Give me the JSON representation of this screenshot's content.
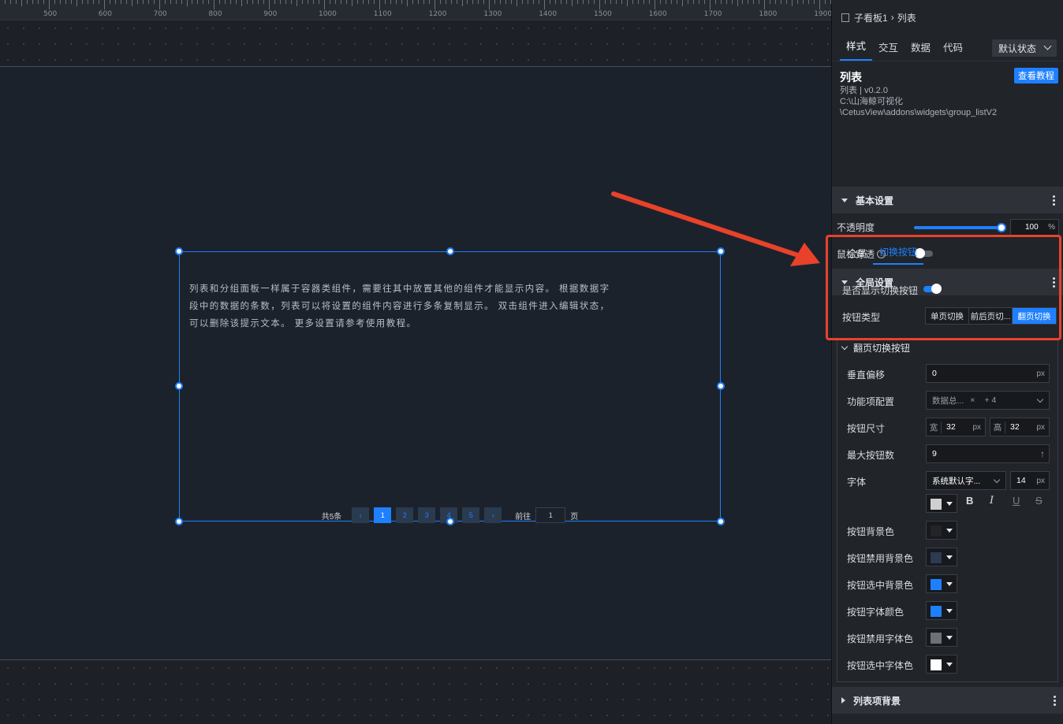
{
  "ruler": {
    "labels": [
      "500",
      "600",
      "700",
      "800",
      "900",
      "1000",
      "1100",
      "1200",
      "1300",
      "1400",
      "1500",
      "1600",
      "1700",
      "1800",
      "1900"
    ]
  },
  "canvas": {
    "hint": "列表和分组面板一样属于容器类组件，需要往其中放置其他的组件才能显示内容。 根据数据字段中的数据的条数，列表可以将设置的组件内容进行多条复制显示。 双击组件进入编辑状态，可以删除该提示文本。 更多设置请参考使用教程。",
    "pager": {
      "total": "共5条",
      "prev": "‹",
      "pages": [
        "1",
        "2",
        "3",
        "4",
        "5"
      ],
      "next": "›",
      "goto": "前往",
      "goto_value": "1",
      "page_unit": "页"
    }
  },
  "panel": {
    "breadcrumb": {
      "parent": "子看板1",
      "sep": "›",
      "current": "列表"
    },
    "tabs": [
      "样式",
      "交互",
      "数据",
      "代码"
    ],
    "state_select": "默认状态",
    "component": {
      "title": "列表",
      "version": "列表 | v0.2.0",
      "path1": "C:\\山海鲸可视化",
      "path2": "\\CetusView\\addons\\widgets\\group_listV2",
      "tutorial": "查看教程"
    },
    "basic": {
      "title": "基本设置",
      "opacity_label": "不透明度",
      "opacity_value": "100",
      "opacity_unit": "%",
      "opacity": 100,
      "mouse_label": "鼠标穿透",
      "help": "?"
    },
    "global": {
      "title": "全局设置",
      "subtabs": [
        "全局",
        "切换按钮"
      ],
      "show_label": "是否显示切换按钮",
      "type_label": "按钮类型",
      "types": [
        "单页切换",
        "前后页切...",
        "翻页切换"
      ]
    },
    "pageturn": {
      "title": "翻页切换按钮",
      "v_offset_label": "垂直偏移",
      "v_offset": "0",
      "px": "px",
      "func_label": "功能项配置",
      "func_value": "数据总...",
      "func_close": "×",
      "func_more": "+ 4",
      "size_label": "按钮尺寸",
      "w_label": "宽",
      "w": "32",
      "h_label": "高",
      "h": "32",
      "max_label": "最大按钮数",
      "max": "9",
      "max_icon": "↑",
      "font_label": "字体",
      "font_value": "系统默认字...",
      "font_size": "14",
      "bold": "B",
      "italic": "I",
      "underline": "U",
      "strike": "S",
      "colors": [
        {
          "label": "按钮背景色",
          "color": "#222428"
        },
        {
          "label": "按钮禁用背景色",
          "color": "#2c3a52"
        },
        {
          "label": "按钮选中背景色",
          "color": "#1e80ff"
        },
        {
          "label": "按钮字体颜色",
          "color": "#1e80ff"
        },
        {
          "label": "按钮禁用字体色",
          "color": "#6e7278"
        },
        {
          "label": "按钮选中字体色",
          "color": "#ffffff"
        }
      ],
      "font_color": "#d0d0d0"
    },
    "list_bg": {
      "title": "列表项背景"
    }
  }
}
